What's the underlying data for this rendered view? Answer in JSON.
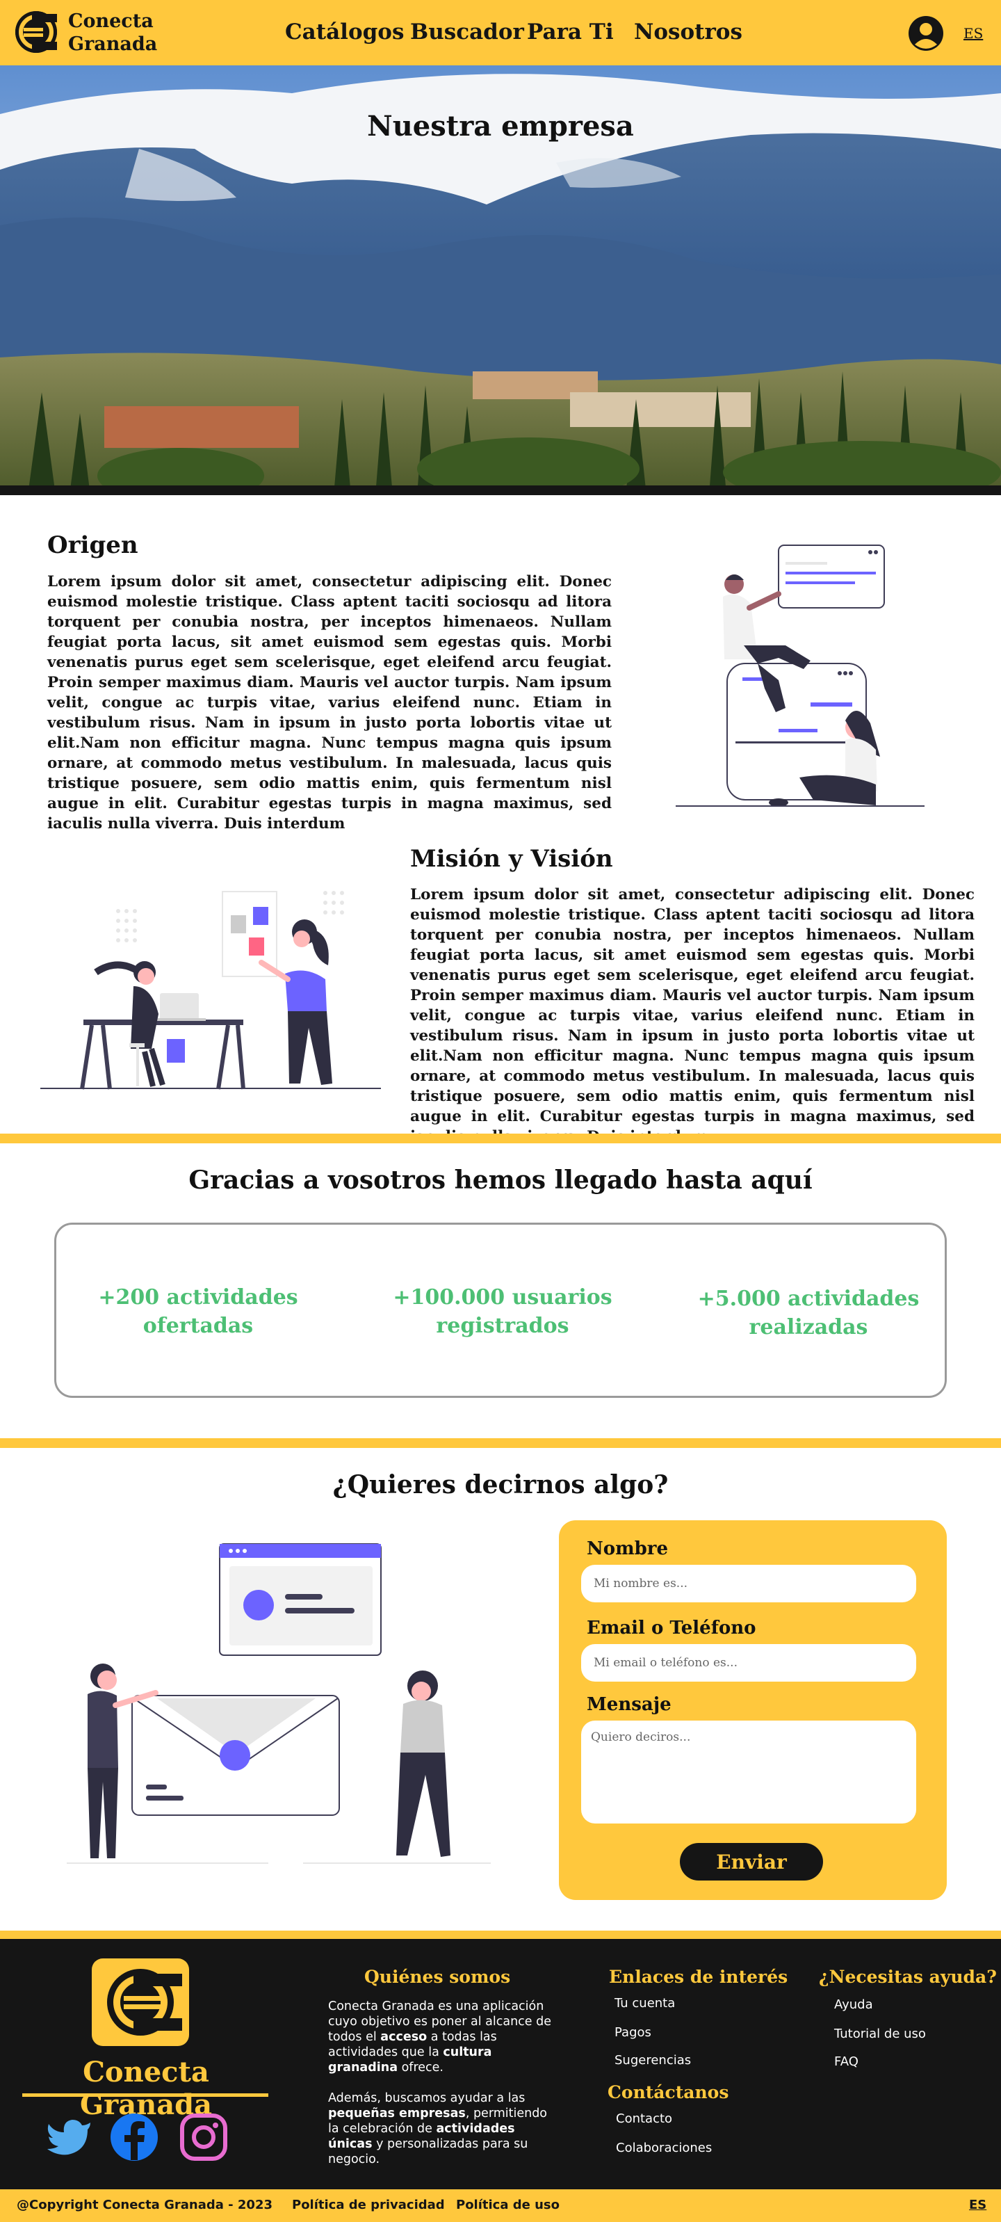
{
  "header": {
    "brand_line1": "Conecta",
    "brand_line2": "Granada",
    "nav": [
      "Catálogos",
      "Buscador",
      "Para Ti",
      "Nosotros"
    ],
    "language": "ES",
    "user_icon": "user-avatar-icon"
  },
  "hero": {
    "title": "Nuestra empresa"
  },
  "origen": {
    "title": "Origen",
    "body": "Lorem ipsum dolor sit amet, consectetur adipiscing elit. Donec euismod molestie tristique. Class aptent taciti sociosqu ad litora torquent per conubia nostra, per inceptos himenaeos. Nullam feugiat porta lacus, sit amet euismod sem egestas quis. Morbi venenatis purus eget sem scelerisque, eget eleifend arcu feugiat. Proin semper maximus diam. Mauris vel auctor turpis. Nam ipsum velit, congue ac turpis vitae, varius eleifend nunc. Etiam in vestibulum risus. Nam in ipsum in justo porta lobortis vitae ut elit.Nam non efficitur magna. Nunc tempus magna quis ipsum ornare, at commodo metus vestibulum. In malesuada, lacus quis tristique posuere, sem odio mattis enim, quis fermentum nisl augue in elit. Curabitur egestas turpis in magna maximus, sed iaculis nulla viverra. Duis interdum"
  },
  "mision": {
    "title": "Misión y Visión",
    "body": "Lorem ipsum dolor sit amet, consectetur adipiscing elit. Donec euismod molestie tristique. Class aptent taciti sociosqu ad litora torquent per conubia nostra, per inceptos himenaeos. Nullam feugiat porta lacus, sit amet euismod sem egestas quis. Morbi venenatis purus eget sem scelerisque, eget eleifend arcu feugiat. Proin semper maximus diam. Mauris vel auctor turpis. Nam ipsum velit, congue ac turpis vitae, varius eleifend nunc. Etiam in vestibulum risus. Nam in ipsum in justo porta lobortis vitae ut elit.Nam non efficitur magna. Nunc tempus magna quis ipsum ornare, at commodo metus vestibulum. In malesuada, lacus quis tristique posuere, sem odio mattis enim, quis fermentum nisl augue in elit. Curabitur egestas turpis in magna maximus, sed iaculis nulla viverra. Duis interdum"
  },
  "stats": {
    "title": "Gracias a vosotros hemos llegado hasta aquí",
    "items": [
      {
        "line1": "+200 actividades",
        "line2": "ofertadas"
      },
      {
        "line1": "+100.000 usuarios",
        "line2": "registrados"
      },
      {
        "line1": "+5.000 actividades",
        "line2": "realizadas"
      }
    ],
    "accent_color": "#4DBF74"
  },
  "contact": {
    "title": "¿Quieres decirnos algo?",
    "name_label": "Nombre",
    "name_placeholder": "Mi nombre es...",
    "email_label": "Email o Teléfono",
    "email_placeholder": "Mi email o teléfono es...",
    "message_label": "Mensaje",
    "message_placeholder": "Quiero deciros...",
    "send_label": "Enviar"
  },
  "footer": {
    "brand": "Conecta Granada",
    "social": [
      "twitter-icon",
      "facebook-icon",
      "instagram-icon"
    ],
    "about_title": "Quiénes somos",
    "about_p1_a": "Conecta Granada es una aplicación cuyo objetivo es poner al alcance de todos el ",
    "about_p1_b": "acceso",
    "about_p1_c": " a todas las actividades que la ",
    "about_p1_d": "cultura granadina",
    "about_p1_e": " ofrece.",
    "about_p2_a": "Además, buscamos ayudar a las ",
    "about_p2_b": "pequeñas empresas",
    "about_p2_c": ", permitiendo la celebración de ",
    "about_p2_d": "actividades únicas",
    "about_p2_e": " y personalizadas para su negocio.",
    "links_title": "Enlaces de interés",
    "links": [
      "Tu cuenta",
      "Pagos",
      "Sugerencias"
    ],
    "contact_title": "Contáctanos",
    "contact_links": [
      "Contacto",
      "Colaboraciones"
    ],
    "help_title": "¿Necesitas ayuda?",
    "help_links": [
      "Ayuda",
      "Tutorial de uso",
      "FAQ"
    ]
  },
  "bottom_bar": {
    "copyright": "@Copyright Conecta Granada - 2023",
    "privacy": "Política de privacidad",
    "terms": "Política de uso",
    "language": "ES"
  },
  "colors": {
    "brand_yellow": "#FFC83D",
    "dark": "#151515",
    "purple": "#6C63FF"
  }
}
